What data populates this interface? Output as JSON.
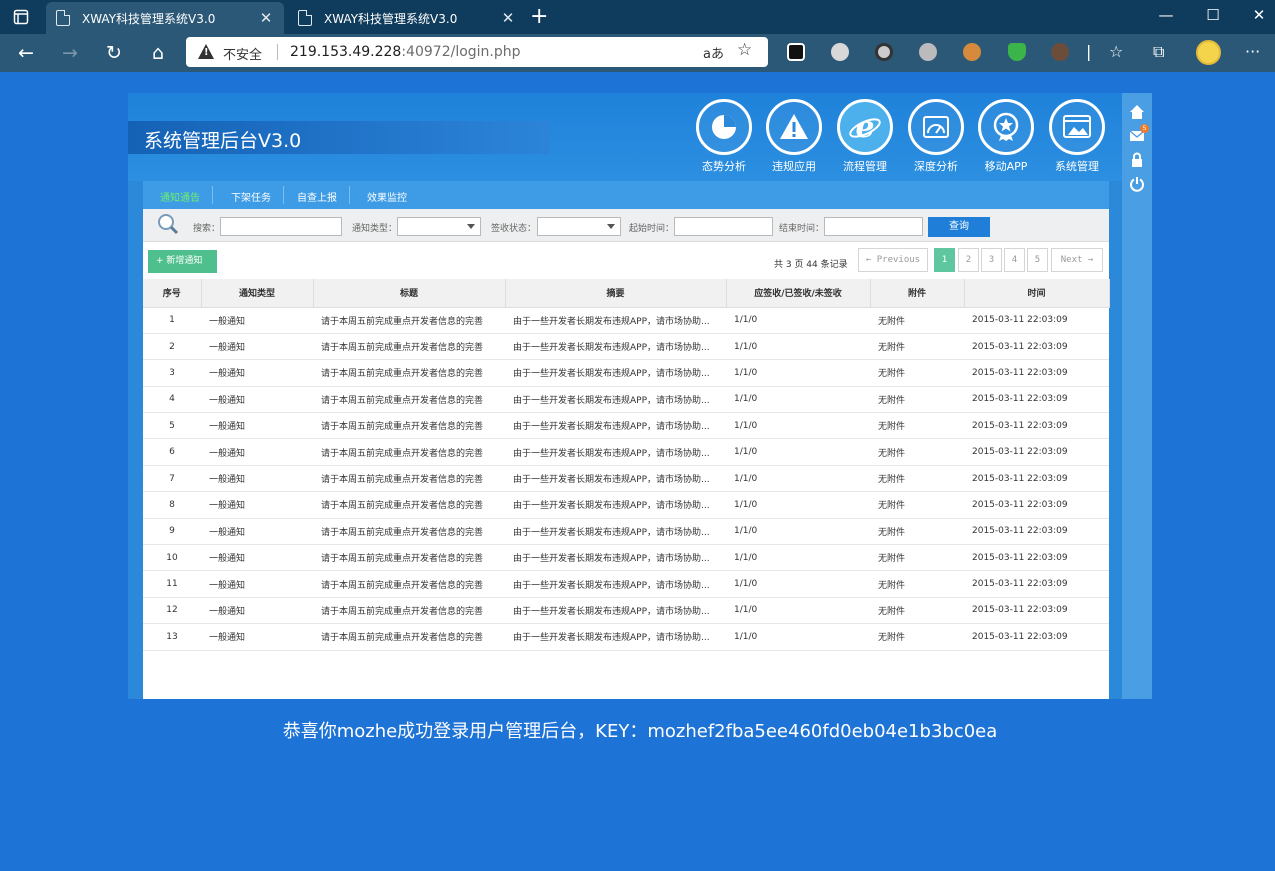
{
  "browser": {
    "tabs": [
      {
        "title": "XWAY科技管理系统V3.0",
        "active": true
      },
      {
        "title": "XWAY科技管理系统V3.0",
        "active": false
      }
    ],
    "address": {
      "security_label": "不安全",
      "host": "219.153.49.228",
      "rest": ":40972/login.php"
    },
    "read_aloud_glyph": "aあ"
  },
  "app": {
    "title": "系统管理后台V3.0",
    "modules": [
      {
        "label": "态势分析",
        "icon": "pie-chart-icon"
      },
      {
        "label": "违规应用",
        "icon": "warning-icon"
      },
      {
        "label": "流程管理",
        "icon": "ie-logo-icon",
        "active": true
      },
      {
        "label": "深度分析",
        "icon": "dashboard-icon"
      },
      {
        "label": "移动APP",
        "icon": "star-badge-icon"
      },
      {
        "label": "系统管理",
        "icon": "window-settings-icon"
      }
    ],
    "subnav": [
      "通知通告",
      "下架任务",
      "自查上报",
      "效果监控"
    ],
    "search": {
      "keyword_label": "搜索：",
      "type_label": "通知类型：",
      "status_label": "签收状态：",
      "start_label": "起始时间：",
      "end_label": "结束时间：",
      "query_button": "查询"
    },
    "add_button": "+ 新增通知",
    "pagination": {
      "info": "共 3 页 44 条记录",
      "prev": "← Previous",
      "pages": [
        "1",
        "2",
        "3",
        "4",
        "5"
      ],
      "current": "1",
      "next": "Next →"
    },
    "table": {
      "headers": [
        "序号",
        "通知类型",
        "标题",
        "摘要",
        "应签收/已签收/未签收",
        "附件",
        "时间"
      ],
      "rows": [
        [
          "1",
          "一般通知",
          "请于本周五前完成重点开发者信息的完善",
          "由于一些开发者长期发布违规APP，请市场协助...",
          "1/1/0",
          "无附件",
          "2015-03-11 22:03:09"
        ],
        [
          "2",
          "一般通知",
          "请于本周五前完成重点开发者信息的完善",
          "由于一些开发者长期发布违规APP，请市场协助...",
          "1/1/0",
          "无附件",
          "2015-03-11 22:03:09"
        ],
        [
          "3",
          "一般通知",
          "请于本周五前完成重点开发者信息的完善",
          "由于一些开发者长期发布违规APP，请市场协助...",
          "1/1/0",
          "无附件",
          "2015-03-11 22:03:09"
        ],
        [
          "4",
          "一般通知",
          "请于本周五前完成重点开发者信息的完善",
          "由于一些开发者长期发布违规APP，请市场协助...",
          "1/1/0",
          "无附件",
          "2015-03-11 22:03:09"
        ],
        [
          "5",
          "一般通知",
          "请于本周五前完成重点开发者信息的完善",
          "由于一些开发者长期发布违规APP，请市场协助...",
          "1/1/0",
          "无附件",
          "2015-03-11 22:03:09"
        ],
        [
          "6",
          "一般通知",
          "请于本周五前完成重点开发者信息的完善",
          "由于一些开发者长期发布违规APP，请市场协助...",
          "1/1/0",
          "无附件",
          "2015-03-11 22:03:09"
        ],
        [
          "7",
          "一般通知",
          "请于本周五前完成重点开发者信息的完善",
          "由于一些开发者长期发布违规APP，请市场协助...",
          "1/1/0",
          "无附件",
          "2015-03-11 22:03:09"
        ],
        [
          "8",
          "一般通知",
          "请于本周五前完成重点开发者信息的完善",
          "由于一些开发者长期发布违规APP，请市场协助...",
          "1/1/0",
          "无附件",
          "2015-03-11 22:03:09"
        ],
        [
          "9",
          "一般通知",
          "请于本周五前完成重点开发者信息的完善",
          "由于一些开发者长期发布违规APP，请市场协助...",
          "1/1/0",
          "无附件",
          "2015-03-11 22:03:09"
        ],
        [
          "10",
          "一般通知",
          "请于本周五前完成重点开发者信息的完善",
          "由于一些开发者长期发布违规APP，请市场协助...",
          "1/1/0",
          "无附件",
          "2015-03-11 22:03:09"
        ],
        [
          "11",
          "一般通知",
          "请于本周五前完成重点开发者信息的完善",
          "由于一些开发者长期发布违规APP，请市场协助...",
          "1/1/0",
          "无附件",
          "2015-03-11 22:03:09"
        ],
        [
          "12",
          "一般通知",
          "请于本周五前完成重点开发者信息的完善",
          "由于一些开发者长期发布违规APP，请市场协助...",
          "1/1/0",
          "无附件",
          "2015-03-11 22:03:09"
        ],
        [
          "13",
          "一般通知",
          "请于本周五前完成重点开发者信息的完善",
          "由于一些开发者长期发布违规APP，请市场协助...",
          "1/1/0",
          "无附件",
          "2015-03-11 22:03:09"
        ]
      ]
    },
    "sidebar_icons": [
      "home-icon",
      "mail-icon",
      "lock-icon",
      "power-icon"
    ],
    "mail_badge": "5"
  },
  "message": "恭喜你mozhe成功登录用户管理后台，KEY：mozhef2fba5ee460fd0eb04e1b3bc0ea",
  "colors": {
    "page_bg": "#1e73d6",
    "accent": "#1f7fd8",
    "active_green": "#5fc7a0"
  }
}
